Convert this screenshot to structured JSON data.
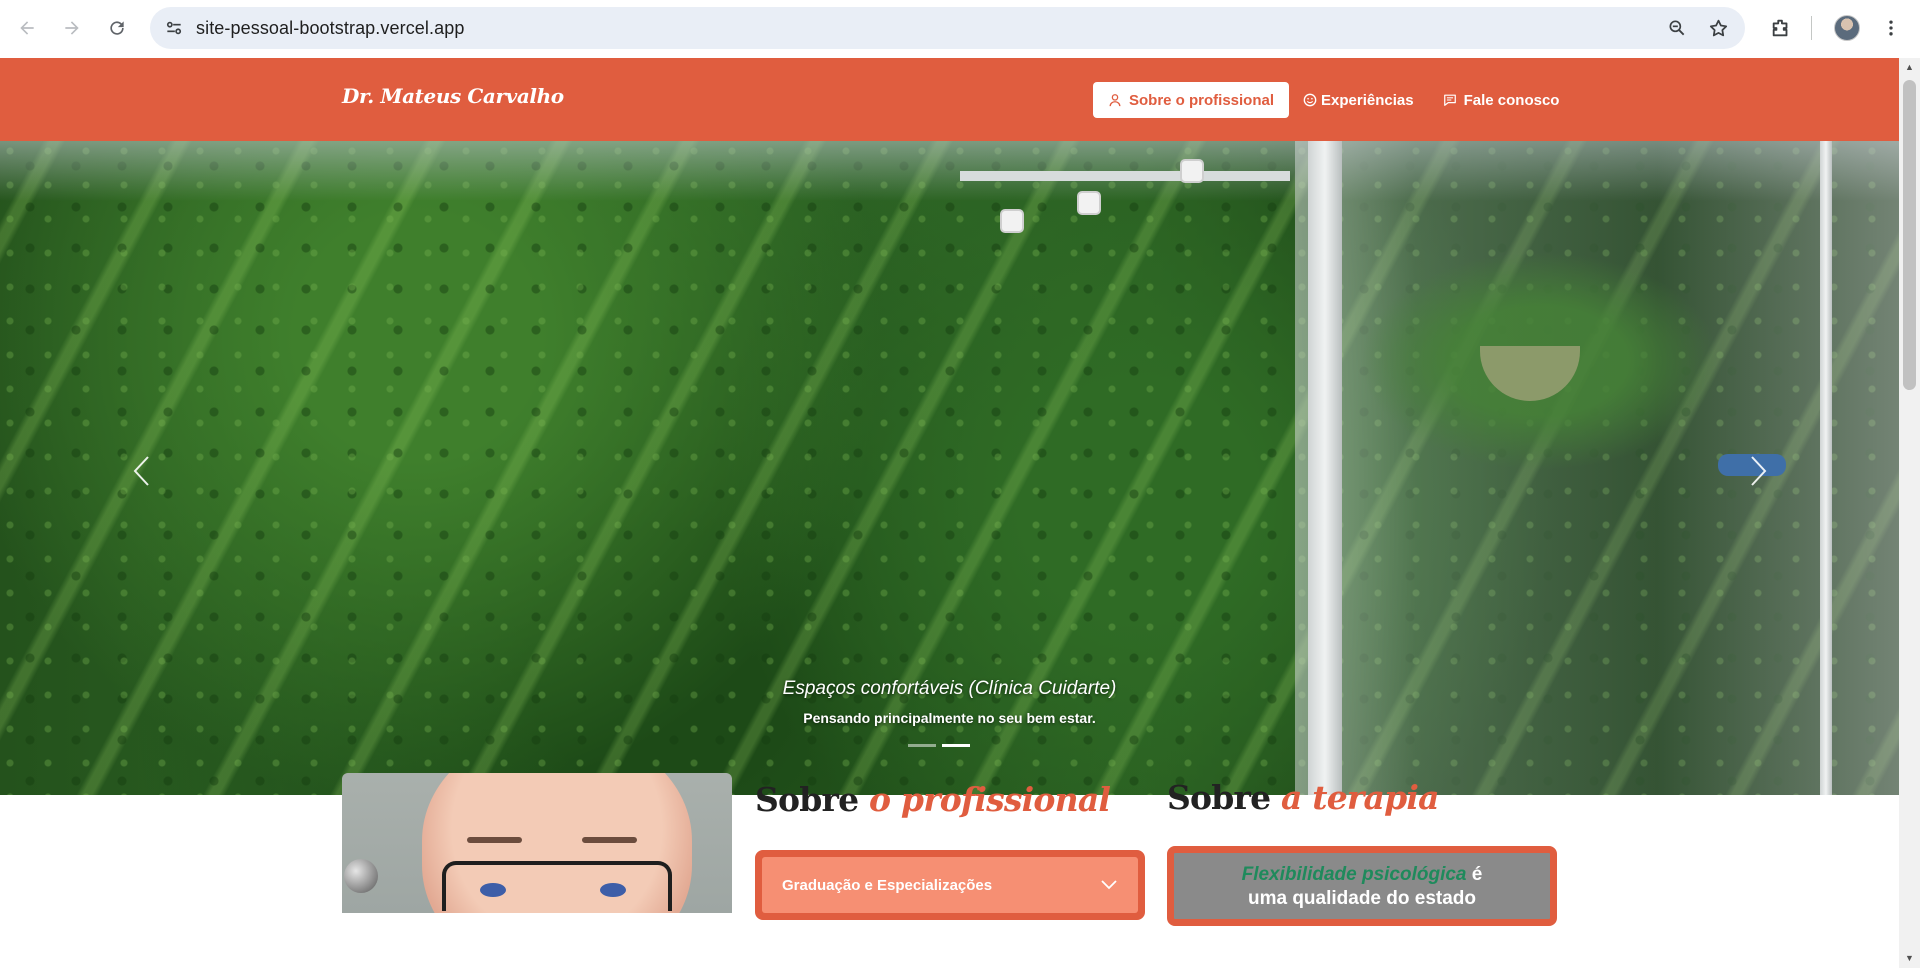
{
  "browser": {
    "url": "site-pessoal-bootstrap.vercel.app",
    "icons": [
      "back-icon",
      "forward-icon",
      "reload-icon",
      "site-info-icon",
      "zoom-icon",
      "bookmark-star-icon",
      "extensions-icon",
      "profile-avatar",
      "menu-kebab-icon"
    ]
  },
  "navbar": {
    "brand": "Dr. Mateus Carvalho",
    "links": [
      {
        "label": "Sobre o profissional",
        "icon": "person-icon",
        "active": true
      },
      {
        "label": "Experiências",
        "icon": "smile-icon",
        "active": false
      },
      {
        "label": "Fale conosco",
        "icon": "chat-icon",
        "active": false
      }
    ],
    "colors": {
      "primary": "#e05d3f",
      "active_bg": "#ffffff"
    }
  },
  "carousel": {
    "caption_title": "Espaços confortáveis (Clínica Cuidarte)",
    "caption_subtitle": "Pensando principalmente no seu bem estar.",
    "indicators": 2,
    "active_indicator": 1
  },
  "about": {
    "title_plain": "Sobre",
    "title_accent": "o profissional",
    "accordion": [
      {
        "label": "Graduação e Especializações",
        "expanded": false
      }
    ]
  },
  "therapy": {
    "title_plain": "Sobre",
    "title_accent": "a terapia",
    "text_highlight": "Flexibilidade psicológica",
    "text_after": "é",
    "text_line2": "uma qualidade do estado"
  }
}
